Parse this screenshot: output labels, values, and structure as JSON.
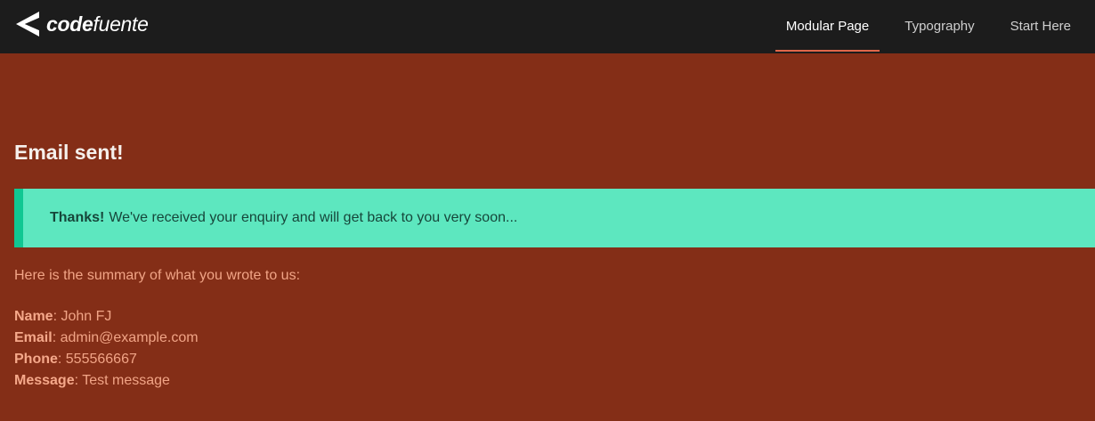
{
  "header": {
    "logo_bold": "code",
    "logo_light": "fuente",
    "nav": [
      {
        "label": "Modular Page",
        "active": true
      },
      {
        "label": "Typography",
        "active": false
      },
      {
        "label": "Start Here",
        "active": false
      }
    ]
  },
  "main": {
    "title": "Email sent!",
    "alert": {
      "strong": "Thanks!",
      "text": "We've received your enquiry and will get back to you very soon..."
    },
    "summary_intro": "Here is the summary of what you wrote to us:",
    "fields": [
      {
        "label": "Name",
        "value": "John FJ"
      },
      {
        "label": "Email",
        "value": "admin@example.com"
      },
      {
        "label": "Phone",
        "value": "555566667"
      },
      {
        "label": "Message",
        "value": "Test message"
      }
    ]
  },
  "colors": {
    "page_bg": "#842e17",
    "topbar_bg": "#1c1c1c",
    "accent": "#e0674a",
    "alert_bg": "#5de7bf",
    "alert_border": "#10c792"
  }
}
